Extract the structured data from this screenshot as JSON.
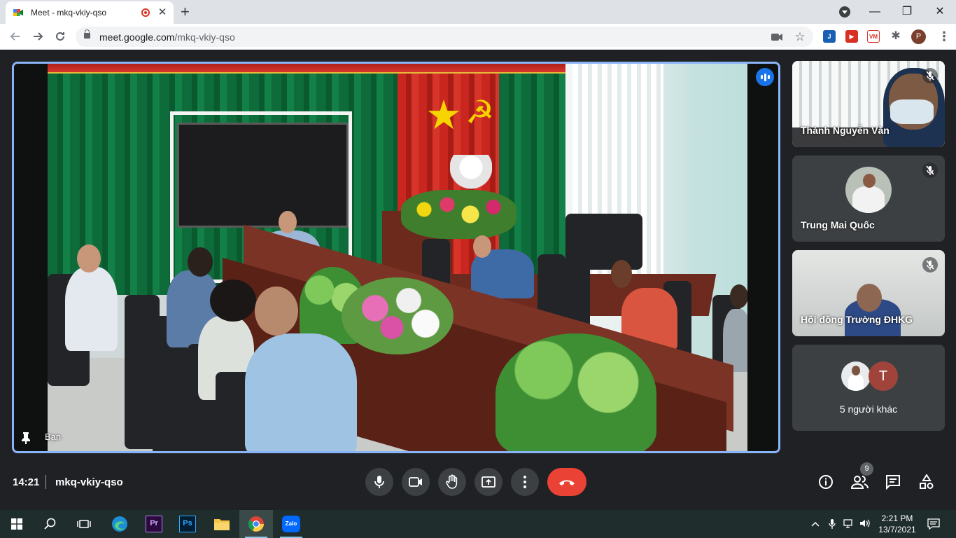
{
  "browser": {
    "tab_title": "Meet - mkq-vkiy-qso",
    "tab_close": "✕",
    "new_tab": "+",
    "url_host": "meet.google.com",
    "url_path": "/mkq-vkiy-qso",
    "window_controls": {
      "minimize": "—",
      "restore": "❐",
      "close": "✕"
    },
    "profile_initial": "P",
    "extensions": [
      {
        "name": "extension-j-icon",
        "label": "J",
        "color": "#1a5fb4"
      },
      {
        "name": "extension-play-icon",
        "label": "▶",
        "color": "#d93025"
      },
      {
        "name": "extension-vm-icon",
        "label": "VM",
        "color": "#e8eaed"
      },
      {
        "name": "extensions-puzzle-icon",
        "label": "✱",
        "color": "#5f6368"
      }
    ]
  },
  "meet": {
    "main_tile": {
      "label": "Bạn"
    },
    "participants": [
      {
        "name": "Thành Nguyễn Văn",
        "muted": true
      },
      {
        "name": "Trung Mai Quốc",
        "muted": true
      },
      {
        "name": "Hội đồng Trường ĐHKG",
        "muted": true
      }
    ],
    "others": {
      "label": "5 người khác",
      "avatar_letter": "T",
      "avatar_color": "#a0443b"
    },
    "bottom": {
      "time": "14:21",
      "meeting_code": "mkq-vkiy-qso",
      "people_count": "9"
    },
    "colors": {
      "accent": "#8ab4f8",
      "end_call": "#ea4335",
      "speaking": "#1a73e8"
    }
  },
  "taskbar": {
    "time": "2:21 PM",
    "date": "13/7/2021",
    "apps": [
      {
        "name": "taskbar-edge",
        "label": ""
      },
      {
        "name": "taskbar-premiere",
        "label": "Pr"
      },
      {
        "name": "taskbar-photoshop",
        "label": "Ps"
      },
      {
        "name": "taskbar-file-explorer",
        "label": ""
      },
      {
        "name": "taskbar-chrome",
        "label": ""
      },
      {
        "name": "taskbar-zalo",
        "label": "Zalo"
      }
    ]
  }
}
